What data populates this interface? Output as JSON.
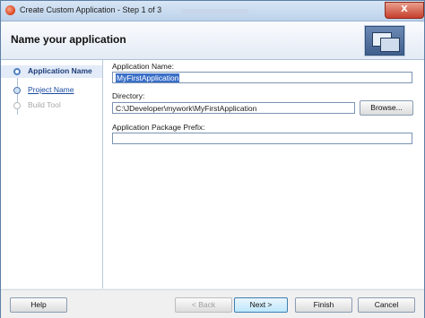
{
  "window": {
    "title": "Create Custom Application - Step 1 of 3",
    "close_glyph": "X"
  },
  "header": {
    "title": "Name your application",
    "graphic_icon": "windows-graphic-icon"
  },
  "steps": [
    {
      "label": "Application Name",
      "state": "current"
    },
    {
      "label": "Project Name",
      "state": "link"
    },
    {
      "label": "Build Tool",
      "state": "disabled"
    }
  ],
  "form": {
    "app_name_label": "Application Name:",
    "app_name_value": "MyFirstApplication",
    "directory_label": "Directory:",
    "directory_value": "C:\\JDeveloper\\mywork\\MyFirstApplication",
    "browse_label": "Browse...",
    "package_prefix_label": "Application Package Prefix:",
    "package_prefix_value": ""
  },
  "footer": {
    "help": "Help",
    "back": "< Back",
    "next": "Next >",
    "finish": "Finish",
    "cancel": "Cancel"
  },
  "colors": {
    "accent": "#3a6fc8",
    "link": "#1a4b9e",
    "current_step": "#1d3a7a",
    "close": "#c63e2b"
  }
}
